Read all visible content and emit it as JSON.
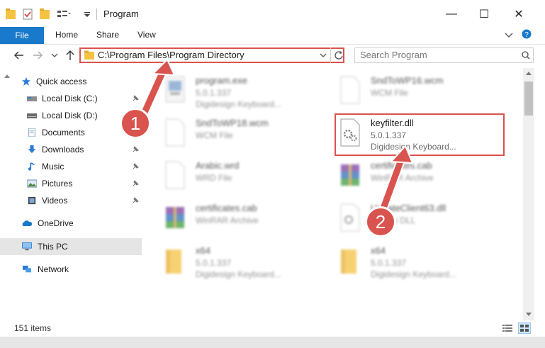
{
  "window": {
    "title": "Program",
    "minimize": "—",
    "maximize": "☐",
    "close": "✕"
  },
  "ribbon": {
    "file": "File",
    "home": "Home",
    "share": "Share",
    "view": "View"
  },
  "address": {
    "path": "C:\\Program Files\\Program Directory",
    "search_placeholder": "Search Program"
  },
  "sidebar": {
    "quick_access": "Quick access",
    "items": [
      {
        "label": "Local Disk (C:)",
        "icon": "drive-icon",
        "pinned": true
      },
      {
        "label": "Local Disk (D:)",
        "icon": "drive-icon",
        "pinned": true
      },
      {
        "label": "Documents",
        "icon": "documents-icon",
        "pinned": true
      },
      {
        "label": "Downloads",
        "icon": "downloads-icon",
        "pinned": true
      },
      {
        "label": "Music",
        "icon": "music-icon",
        "pinned": true
      },
      {
        "label": "Pictures",
        "icon": "pictures-icon",
        "pinned": true
      },
      {
        "label": "Videos",
        "icon": "videos-icon",
        "pinned": true
      }
    ],
    "onedrive": "OneDrive",
    "this_pc": "This PC",
    "network": "Network"
  },
  "files": [
    {
      "name": "program.exe",
      "line2": "5.0.1.337",
      "line3": "Digidesign Keyboard...",
      "icon": "exe-icon"
    },
    {
      "name": "SndToWP16.wcm",
      "line2": "WCM File",
      "line3": "",
      "icon": "file-icon"
    },
    {
      "name": "SndToWP18.wcm",
      "line2": "WCM File",
      "line3": "",
      "icon": "file-icon"
    },
    {
      "name": "keyfilter.dll",
      "line2": "5.0.1.337",
      "line3": "Digidesign Keyboard...",
      "icon": "dll-icon"
    },
    {
      "name": "Arabic.wrd",
      "line2": "WRD File",
      "line3": "",
      "icon": "file-icon"
    },
    {
      "name": "certificates.cab",
      "line2": "WinRAR Archive",
      "line3": "",
      "icon": "winrar-icon"
    },
    {
      "name": "certificates.cab",
      "line2": "WinRAR Archive",
      "line3": "",
      "icon": "winrar-icon"
    },
    {
      "name": "UpdateClient63.dll",
      "line2": "Source DLL",
      "line3": "",
      "icon": "dll-icon"
    },
    {
      "name": "x64",
      "line2": "5.0.1.337",
      "line3": "Digidesign Keyboard...",
      "icon": "folder-icon"
    },
    {
      "name": "x64",
      "line2": "5.0.1.337",
      "line3": "Digidesign Keyboard...",
      "icon": "folder-icon"
    }
  ],
  "status": {
    "count": "151 items"
  },
  "badges": {
    "one": "1",
    "two": "2"
  },
  "colors": {
    "accent": "#1979ca",
    "highlight": "#d9534f",
    "folder": "#f5c242"
  }
}
